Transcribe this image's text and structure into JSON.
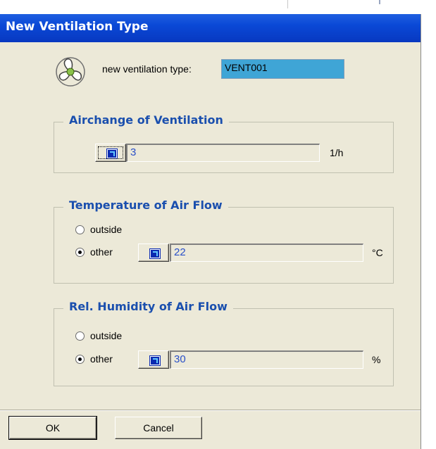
{
  "dialog": {
    "title": "New Ventilation Type",
    "name_label": "new ventilation type:",
    "name_value": "VENT001"
  },
  "airchange": {
    "title": "Airchange of Ventilation",
    "value": "3",
    "unit": "1/h"
  },
  "temperature": {
    "title": "Temperature of Air Flow",
    "option_outside": "outside",
    "option_other": "other",
    "selected": "other",
    "value": "22",
    "unit": "°C"
  },
  "humidity": {
    "title": "Rel. Humidity of Air Flow",
    "option_outside": "outside",
    "option_other": "other",
    "selected": "other",
    "value": "30",
    "unit": "%"
  },
  "buttons": {
    "ok": "OK",
    "cancel": "Cancel"
  },
  "icons": {
    "vent": "fan-icon",
    "lookup": "lookup-icon"
  },
  "colors": {
    "titlebar": "#0a48d6",
    "group_title": "#1a4fae",
    "name_field_bg": "#3fa5d6",
    "value_text": "#2a50c8",
    "dialog_bg": "#ece9d8"
  }
}
